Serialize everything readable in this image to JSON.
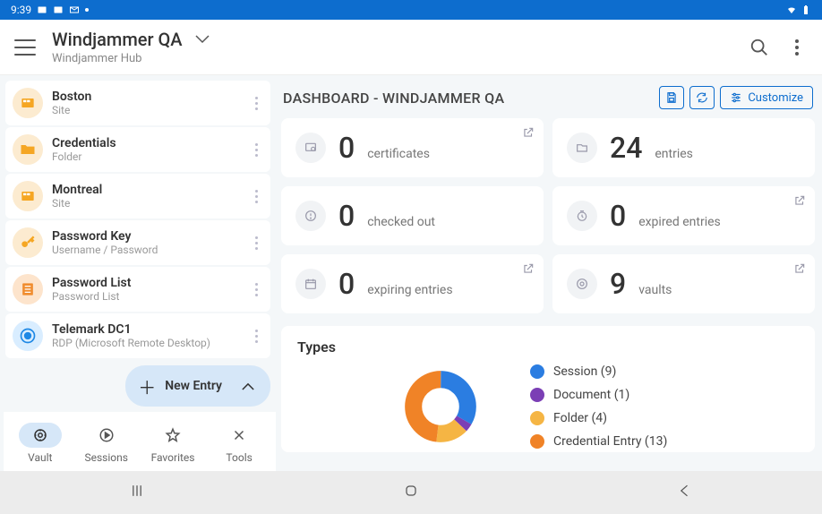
{
  "status": {
    "time": "9:39"
  },
  "header": {
    "title": "Windjammer QA",
    "subtitle": "Windjammer Hub"
  },
  "sidebar": {
    "items": [
      {
        "title": "Boston",
        "sub": "Site",
        "iconColor": "#f5a623",
        "shape": "site"
      },
      {
        "title": "Credentials",
        "sub": "Folder",
        "iconColor": "#f5a623",
        "shape": "folder"
      },
      {
        "title": "Montreal",
        "sub": "Site",
        "iconColor": "#f5a623",
        "shape": "site"
      },
      {
        "title": "Password Key",
        "sub": "Username / Password",
        "iconColor": "#f5a623",
        "shape": "key"
      },
      {
        "title": "Password List",
        "sub": "Password List",
        "iconColor": "#f08c2e",
        "shape": "list"
      },
      {
        "title": "Telemark DC1",
        "sub": "RDP (Microsoft Remote Desktop)",
        "iconColor": "#1e88e5",
        "shape": "rdp"
      }
    ],
    "newEntry": "New Entry",
    "tabs": [
      {
        "label": "Vault",
        "icon": "vault",
        "active": true
      },
      {
        "label": "Sessions",
        "icon": "play",
        "active": false
      },
      {
        "label": "Favorites",
        "icon": "star",
        "active": false
      },
      {
        "label": "Tools",
        "icon": "tools",
        "active": false
      }
    ]
  },
  "dashboard": {
    "title": "DASHBOARD - WINDJAMMER QA",
    "customize": "Customize",
    "cards": [
      {
        "value": "0",
        "label": "certificates",
        "ext": true,
        "icon": "cert"
      },
      {
        "value": "24",
        "label": "entries",
        "ext": false,
        "icon": "entries"
      },
      {
        "value": "0",
        "label": "checked out",
        "ext": false,
        "icon": "checkout"
      },
      {
        "value": "0",
        "label": "expired entries",
        "ext": true,
        "icon": "clock"
      },
      {
        "value": "0",
        "label": "expiring entries",
        "ext": true,
        "icon": "calendar"
      },
      {
        "value": "9",
        "label": "vaults",
        "ext": true,
        "icon": "vault"
      }
    ],
    "types": {
      "title": "Types",
      "legend": [
        {
          "label": "Session (9)",
          "color": "#2b7de1"
        },
        {
          "label": "Document (1)",
          "color": "#7b3fb5"
        },
        {
          "label": "Folder (4)",
          "color": "#f5b544"
        },
        {
          "label": "Credential Entry (13)",
          "color": "#f08327"
        }
      ]
    }
  },
  "chart_data": {
    "type": "pie",
    "title": "Types",
    "categories": [
      "Session",
      "Document",
      "Folder",
      "Credential Entry"
    ],
    "values": [
      9,
      1,
      4,
      13
    ],
    "colors": [
      "#2b7de1",
      "#7b3fb5",
      "#f5b544",
      "#f08327"
    ]
  }
}
